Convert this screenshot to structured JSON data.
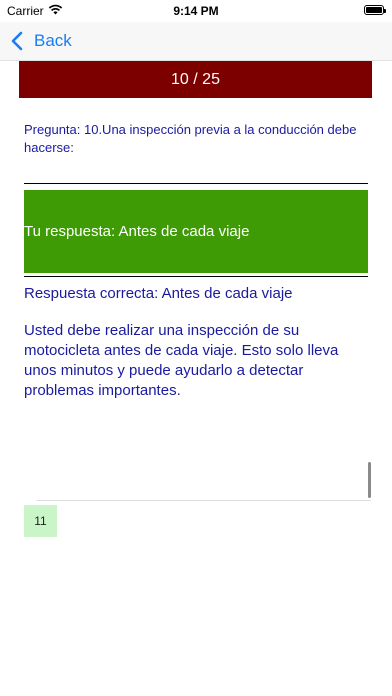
{
  "status_bar": {
    "carrier": "Carrier",
    "time": "9:14 PM",
    "wifi_icon": "wifi-icon",
    "battery_icon": "battery-icon"
  },
  "nav": {
    "back_label": "Back",
    "back_icon": "chevron-left-icon",
    "accent_color": "#1a7cf5"
  },
  "progress": {
    "label": "10 / 25",
    "background_color": "#7c0000"
  },
  "question": {
    "text": "Pregunta: 10.Una inspección previa a la conducción debe hacerse:"
  },
  "answer": {
    "text": "Tu respuesta: Antes de cada viaje",
    "background_color": "#3e9b06"
  },
  "correct_answer": {
    "text": "Respuesta correcta: Antes de cada viaje"
  },
  "explanation": {
    "text": " Usted debe realizar una inspección de su motocicleta antes de cada viaje. Esto solo lleva unos minutos y puede ayudarlo a detectar problemas importantes."
  },
  "question_list": {
    "items": [
      {
        "label": "11"
      }
    ]
  }
}
